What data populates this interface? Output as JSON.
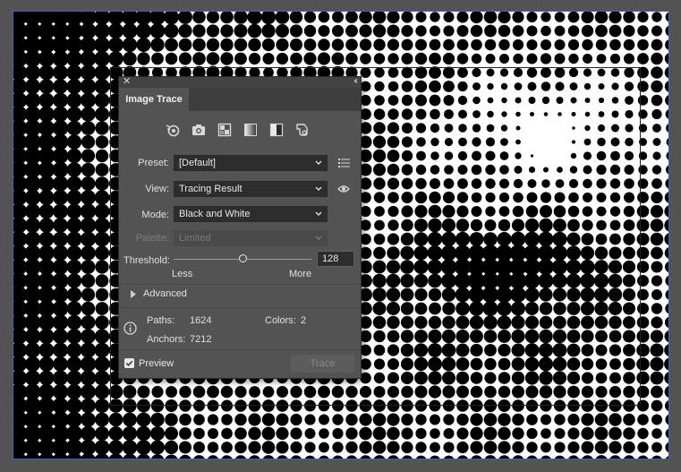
{
  "panel": {
    "tab_title": "Image Trace",
    "preset_icons": [
      "auto-color-icon",
      "high-color-icon",
      "low-color-icon",
      "grayscale-icon",
      "black-and-white-icon",
      "outline-icon"
    ],
    "preset": {
      "label": "Preset:",
      "value": "[Default]"
    },
    "view": {
      "label": "View:",
      "value": "Tracing Result"
    },
    "mode": {
      "label": "Mode:",
      "value": "Black and White"
    },
    "palette": {
      "label": "Palette:",
      "value": "Limited"
    },
    "threshold": {
      "label": "Threshold:",
      "value": "128",
      "min": 1,
      "max": 255,
      "less_label": "Less",
      "more_label": "More"
    },
    "advanced_label": "Advanced",
    "stats": {
      "paths_label": "Paths:",
      "paths_value": "1624",
      "colors_label": "Colors:",
      "colors_value": "2",
      "anchors_label": "Anchors:",
      "anchors_value": "7212"
    },
    "preview": {
      "label": "Preview",
      "checked": true
    },
    "trace_button": "Trace"
  },
  "colors": {
    "workspace": "#535353",
    "panel_bg": "#535353",
    "artboard_border": "#3b63c7",
    "halftone_dot": "#000000"
  }
}
